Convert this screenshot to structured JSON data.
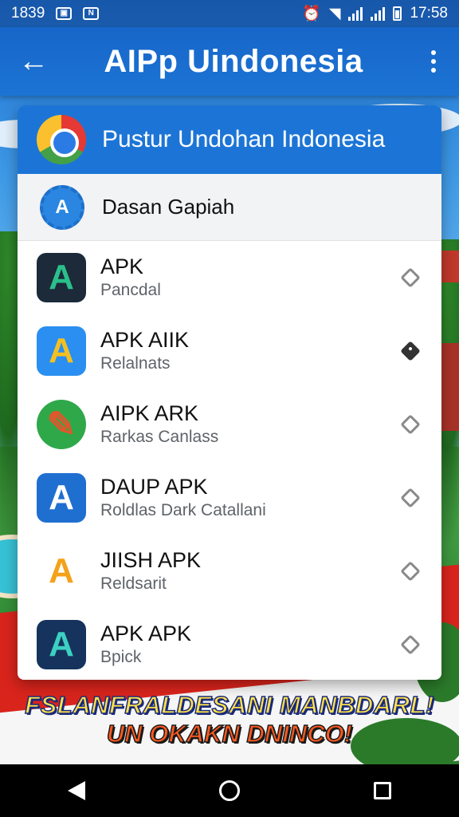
{
  "status_bar": {
    "time": "1839",
    "clock": "17:58",
    "icons": [
      "image-icon",
      "n-icon",
      "alarm-icon",
      "wifi-icon",
      "signal-icon",
      "signal-icon",
      "battery-icon"
    ]
  },
  "app_bar": {
    "title": "AIPp Uindonesia",
    "back_icon": "arrow-left-icon",
    "menu_icon": "more-vertical-icon"
  },
  "card": {
    "header_title": "Pustur Undohan Indonesia",
    "header_icon": "colorful-logo-icon",
    "section_title": "Dasan Gapiah",
    "section_icon": "gear-a-icon"
  },
  "apps": [
    {
      "name": "APK",
      "subtitle": "Pancdal",
      "icon_letter": "A",
      "icon_color": "#1c2a3a",
      "accent": "#2bbf8a",
      "tag": "tag-icon"
    },
    {
      "name": "APK  AIIK",
      "subtitle": "Relalnats",
      "icon_letter": "A",
      "icon_color": "#2a8ff0",
      "accent": "#f4c021",
      "tag": "tag-icon"
    },
    {
      "name": "AIPK  ARK",
      "subtitle": "Rarkas Canlass",
      "icon_letter": "A",
      "icon_color": "#2fa84a",
      "accent": "#e2562b",
      "tag": "tag-icon"
    },
    {
      "name": "DAUP APK",
      "subtitle": "Roldlas Dark Catallani",
      "icon_letter": "A",
      "icon_color": "#1f6fd0",
      "accent": "#ffffff",
      "tag": "tag-icon"
    },
    {
      "name": "JIISH APK",
      "subtitle": "Reldsarit",
      "icon_letter": "A",
      "icon_color": "#ffffff",
      "accent": "#f4a219",
      "tag": "tag-icon"
    },
    {
      "name": "APK  APK",
      "subtitle": "Bpick",
      "icon_letter": "A",
      "icon_color": "#15335c",
      "accent": "#3cd0c2",
      "tag": "tag-icon"
    }
  ],
  "banner": {
    "line1": "FSLANFRALDESANI MANBDARL!",
    "line2": "UN OKAKN DNINCO!"
  },
  "nav": {
    "back": "back-triangle-icon",
    "home": "home-circle-icon",
    "recent": "recent-square-icon"
  }
}
